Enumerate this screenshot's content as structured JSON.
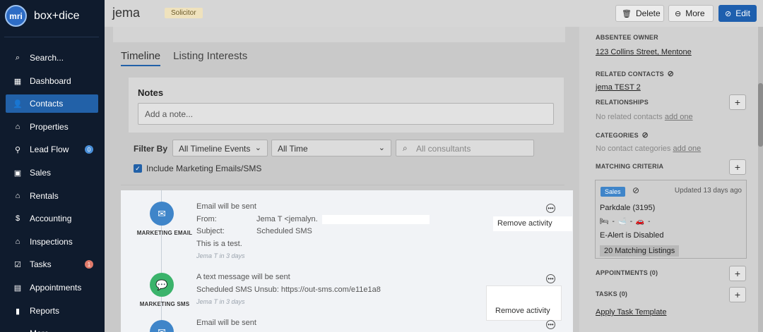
{
  "brand": {
    "logo": "mri",
    "name": "box+dice"
  },
  "sidebar": {
    "items": [
      {
        "label": "Search...",
        "icon": "search-icon",
        "glyph": "⌕",
        "active": false,
        "badge": ""
      },
      {
        "label": "Dashboard",
        "icon": "dashboard-icon",
        "glyph": "▦",
        "active": false,
        "badge": ""
      },
      {
        "label": "Contacts",
        "icon": "person-icon",
        "glyph": "👤",
        "active": true,
        "badge": ""
      },
      {
        "label": "Properties",
        "icon": "house-icon",
        "glyph": "⌂",
        "active": false,
        "badge": ""
      },
      {
        "label": "Lead Flow",
        "icon": "funnel-icon",
        "glyph": "⚲",
        "active": false,
        "badge": "0",
        "badge_color": "#4a90d9"
      },
      {
        "label": "Sales",
        "icon": "sales-icon",
        "glyph": "▣",
        "active": false,
        "badge": ""
      },
      {
        "label": "Rentals",
        "icon": "key-house-icon",
        "glyph": "⌂",
        "active": false,
        "badge": ""
      },
      {
        "label": "Accounting",
        "icon": "dollar-icon",
        "glyph": "$",
        "active": false,
        "badge": ""
      },
      {
        "label": "Inspections",
        "icon": "inspection-icon",
        "glyph": "⌂",
        "active": false,
        "badge": ""
      },
      {
        "label": "Tasks",
        "icon": "tasks-icon",
        "glyph": "☑",
        "active": false,
        "badge": "1",
        "badge_color": "#e07a6a"
      },
      {
        "label": "Appointments",
        "icon": "calendar-icon",
        "glyph": "▤",
        "active": false,
        "badge": ""
      },
      {
        "label": "Reports",
        "icon": "bar-chart-icon",
        "glyph": "▮",
        "active": false,
        "badge": ""
      },
      {
        "label": "More",
        "icon": "more-icon",
        "glyph": "…",
        "active": false,
        "badge": ""
      }
    ]
  },
  "header": {
    "contact_name": "jema",
    "role": "Solicitor",
    "delete_label": "Delete",
    "more_label": "More",
    "edit_label": "Edit"
  },
  "tabs": [
    "Timeline",
    "Listing Interests"
  ],
  "notes": {
    "title": "Notes",
    "placeholder": "Add a note..."
  },
  "filter": {
    "label": "Filter By",
    "events_value": "All Timeline Events",
    "time_value": "All Time",
    "consultants_placeholder": "All consultants",
    "include_marketing_label": "Include Marketing Emails/SMS"
  },
  "timeline": {
    "entry1": {
      "type": "MARKETING EMAIL",
      "title": "Email will be sent",
      "from_label": "From:",
      "from_value": "Jema T <jemalyn.",
      "subject_label": "Subject:",
      "subject_value": "Scheduled SMS",
      "body": "This is a test.",
      "meta": "Jema T in 3 days",
      "menu_item": "Remove activity"
    },
    "entry2": {
      "type": "MARKETING SMS",
      "title": "A text message will be sent",
      "body": "Scheduled SMS Unsub: https://out-sms.com/e11e1a8",
      "meta": "Jema T in 3 days",
      "menu_item": "Remove activity"
    },
    "entry3": {
      "title": "Email will be sent"
    }
  },
  "right_panel": {
    "absentee_owner_heading": "ABSENTEE OWNER",
    "absentee_owner_address": "123 Collins Street, Mentone",
    "related_contacts_heading": "RELATED CONTACTS",
    "related_contact": "jema TEST 2",
    "relationships_heading": "RELATIONSHIPS",
    "relationships_empty": "No related contacts ",
    "relationships_add": "add one",
    "categories_heading": "CATEGORIES",
    "categories_empty": "No contact categories ",
    "categories_add": "add one",
    "matching_heading": "MATCHING CRITERIA",
    "matching": {
      "tag": "Sales",
      "updated": "Updated 13 days ago",
      "location": "Parkdale (3195)",
      "features": "🛏 - 🛁 - 🚗 -",
      "alert": "E-Alert is Disabled",
      "listings": "20 Matching Listings"
    },
    "appointments_heading": "APPOINTMENTS (0)",
    "tasks_heading": "TASKS (0)",
    "apply_task_template": "Apply Task Template"
  }
}
